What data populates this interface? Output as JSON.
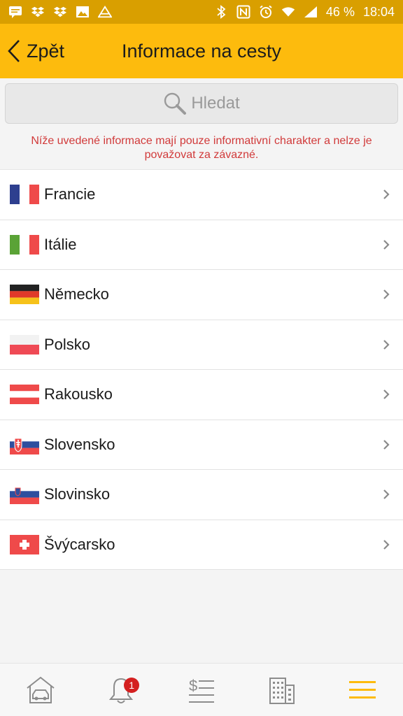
{
  "status_bar": {
    "battery": "46 %",
    "time": "18:04",
    "left_icons": [
      "message-icon",
      "dropbox-icon",
      "dropbox-icon",
      "image-icon",
      "maps-icon"
    ],
    "right_icons": [
      "bluetooth-icon",
      "nfc-icon",
      "alarm-icon",
      "wifi-icon",
      "signal-icon"
    ]
  },
  "header": {
    "back_label": "Zpět",
    "title": "Informace na cesty"
  },
  "search": {
    "placeholder": "Hledat"
  },
  "notice": "Níže uvedené informace mají pouze informativní charakter a nelze je považovat za závazné.",
  "countries": [
    {
      "label": "Francie",
      "flag": "france-flag"
    },
    {
      "label": "Itálie",
      "flag": "italy-flag"
    },
    {
      "label": "Německo",
      "flag": "germany-flag"
    },
    {
      "label": "Polsko",
      "flag": "poland-flag"
    },
    {
      "label": "Rakousko",
      "flag": "austria-flag"
    },
    {
      "label": "Slovensko",
      "flag": "slovakia-flag"
    },
    {
      "label": "Slovinsko",
      "flag": "slovenia-flag"
    },
    {
      "label": "Švýcarsko",
      "flag": "switzerland-flag"
    }
  ],
  "tabbar": {
    "notification_count": "1",
    "tabs": [
      "car-home-icon",
      "bell-icon",
      "payments-icon",
      "building-icon",
      "menu-icon"
    ],
    "active_color": "#fdbb0d"
  },
  "colors": {
    "accent": "#fdbb0d",
    "status_bar": "#d99f00",
    "notice": "#d13a3a"
  }
}
